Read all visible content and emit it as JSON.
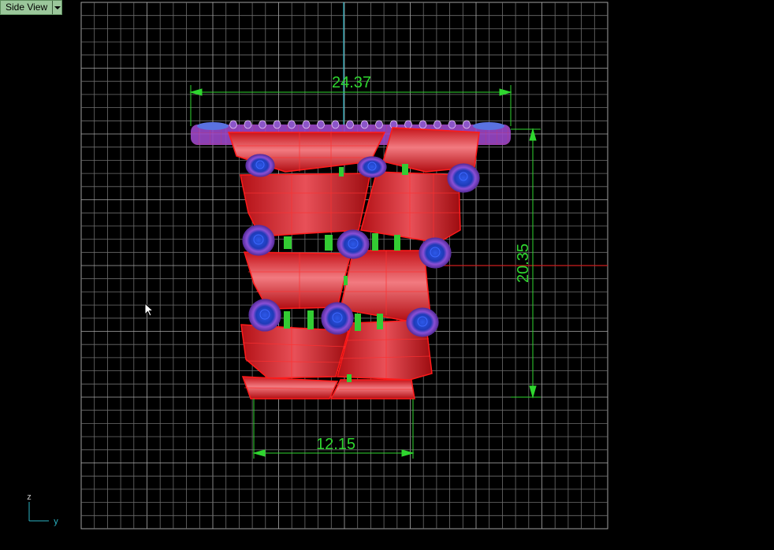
{
  "viewport": {
    "title": "Side View",
    "menu_icon": "chevron-down-icon"
  },
  "dimensions": {
    "width_top": "24.37",
    "height_right": "20.35",
    "width_bottom": "12.15"
  },
  "axes": {
    "vertical": "z",
    "horizontal": "y"
  },
  "colors": {
    "background": "#000000",
    "grid": "#8a8a8a",
    "dimension": "#2fd62f",
    "model_red": "#e0191a",
    "band_purple": "#b05ad6",
    "ball_blue": "#2f4fd8",
    "axis_cyan": "#2bb4c4",
    "axis_red": "#cc1d1d"
  }
}
